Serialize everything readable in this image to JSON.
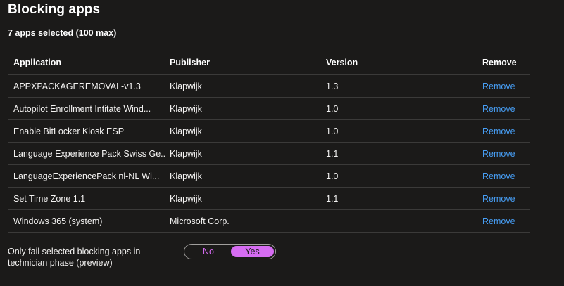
{
  "section": {
    "title": "Blocking apps",
    "subtitle": "7 apps selected (100 max)"
  },
  "table": {
    "columns": [
      "Application",
      "Publisher",
      "Version",
      "Remove"
    ],
    "rows": [
      {
        "application": "APPXPACKAGEREMOVAL-v1.3",
        "publisher": "Klapwijk",
        "version": "1.3",
        "remove": "Remove"
      },
      {
        "application": "Autopilot Enrollment Intitate Wind...",
        "publisher": "Klapwijk",
        "version": "1.0",
        "remove": "Remove"
      },
      {
        "application": "Enable BitLocker Kiosk ESP",
        "publisher": "Klapwijk",
        "version": "1.0",
        "remove": "Remove"
      },
      {
        "application": "Language Experience Pack Swiss Ge...",
        "publisher": "Klapwijk",
        "version": "1.1",
        "remove": "Remove"
      },
      {
        "application": "LanguageExperiencePack nl-NL Wi...",
        "publisher": "Klapwijk",
        "version": "1.0",
        "remove": "Remove"
      },
      {
        "application": "Set Time Zone 1.1",
        "publisher": "Klapwijk",
        "version": "1.1",
        "remove": "Remove"
      },
      {
        "application": "Windows 365 (system)",
        "publisher": "Microsoft Corp.",
        "version": "",
        "remove": "Remove"
      }
    ]
  },
  "toggle": {
    "label": "Only fail selected blocking apps in technician phase (preview)",
    "options": [
      "No",
      "Yes"
    ],
    "selected": "Yes"
  },
  "colors": {
    "background": "#1b1a19",
    "link": "#479ef5",
    "toggle_accent": "#d66cf2",
    "divider": "#3b3a39"
  }
}
